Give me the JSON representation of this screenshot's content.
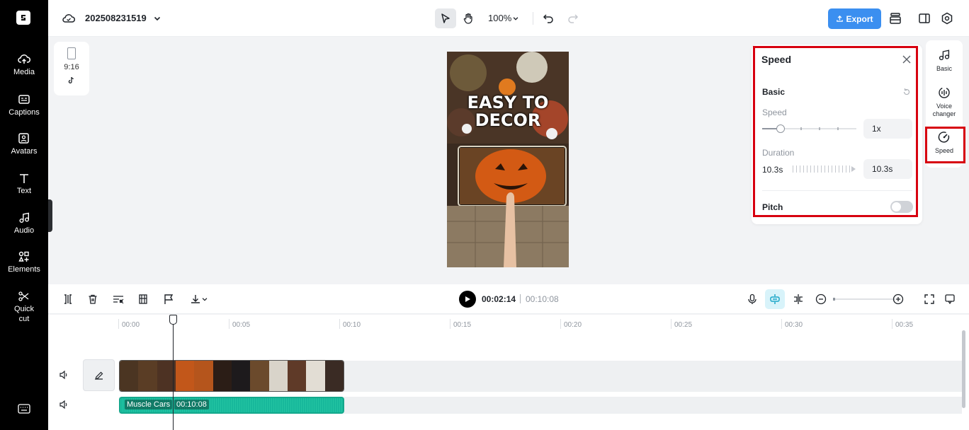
{
  "project": {
    "name": "202508231519"
  },
  "topbar": {
    "zoom": "100%",
    "export_label": "Export"
  },
  "leftnav": {
    "items": [
      {
        "id": "media",
        "label": "Media"
      },
      {
        "id": "captions",
        "label": "Captions"
      },
      {
        "id": "avatars",
        "label": "Avatars"
      },
      {
        "id": "text",
        "label": "Text"
      },
      {
        "id": "audio",
        "label": "Audio"
      },
      {
        "id": "elements",
        "label": "Elements"
      },
      {
        "id": "quickcut",
        "label": "Quick cut"
      }
    ]
  },
  "canvas": {
    "ratio": "9:16",
    "preview_title_line1": "EASY TO",
    "preview_title_line2": "DECOR"
  },
  "speed_panel": {
    "title": "Speed",
    "section_basic": "Basic",
    "speed_label": "Speed",
    "speed_value": "1x",
    "duration_label": "Duration",
    "duration_original": "10.3s",
    "duration_value": "10.3s",
    "pitch_label": "Pitch",
    "pitch_enabled": false
  },
  "right_tabs": [
    {
      "id": "basic",
      "label": "Basic"
    },
    {
      "id": "voice",
      "label": "Voice changer"
    },
    {
      "id": "speed",
      "label": "Speed",
      "active": true
    }
  ],
  "playback": {
    "current": "00:02:14",
    "total": "00:10:08"
  },
  "timeline": {
    "ticks": [
      "00:00",
      "00:05",
      "00:10",
      "00:15",
      "00:20",
      "00:25",
      "00:30",
      "00:35"
    ],
    "audio_clip": {
      "name": "Muscle Cars",
      "duration": "00:10:08"
    }
  },
  "colors": {
    "accent": "#3b8ff0",
    "highlight": "#d7000f",
    "audio_clip": "#17b89b",
    "nav_bg": "#000000"
  }
}
